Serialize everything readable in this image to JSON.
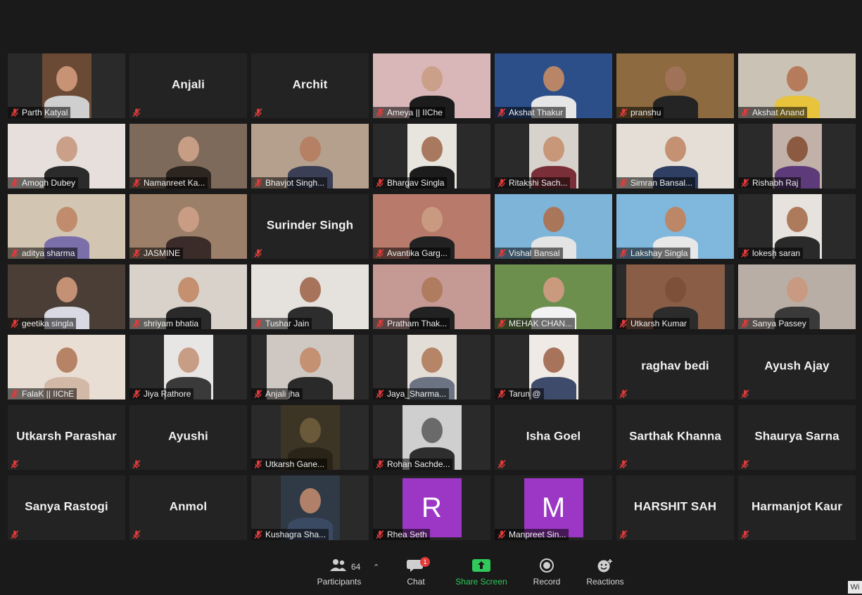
{
  "participants": [
    {
      "name": "Parth Katyal",
      "video": true,
      "bg": "#6b4a35",
      "skin": "#c89374",
      "shirt": "#cfcfcf",
      "frame": 70
    },
    {
      "name": "Anjali",
      "video": false
    },
    {
      "name": "Archit",
      "video": false
    },
    {
      "name": "Ameya || IIChe",
      "video": true,
      "bg": "#d9b7b9",
      "skin": "#caa08a",
      "shirt": "#1c1c1c",
      "frame": 0
    },
    {
      "name": "Akshat Thakur",
      "video": true,
      "bg": "#2c4f8a",
      "skin": "#b88667",
      "shirt": "#e6e6e6",
      "frame": 0
    },
    {
      "name": "pranshu",
      "video": true,
      "bg": "#8d6a3f",
      "skin": "#a07258",
      "shirt": "#242424",
      "frame": 0
    },
    {
      "name": "Akshat Anand",
      "video": true,
      "bg": "#c9c2b5",
      "skin": "#b57b5a",
      "shirt": "#e7c43c",
      "frame": 0
    },
    {
      "name": "Amogh Dubey",
      "video": true,
      "bg": "#e7dfdb",
      "skin": "#caa089",
      "shirt": "#2b2b2b",
      "frame": 0
    },
    {
      "name": "Namanreet Ka...",
      "video": true,
      "bg": "#7d6a5b",
      "skin": "#c79d84",
      "shirt": "#2d2520",
      "frame": 0
    },
    {
      "name": "Bhavjot Singh...",
      "video": true,
      "bg": "#b5a08d",
      "skin": "#b58064",
      "shirt": "#3a3f55",
      "frame": 0
    },
    {
      "name": "Bhargav Singla",
      "video": true,
      "bg": "#e8e4de",
      "skin": "#a8795e",
      "shirt": "#1c1c1c",
      "frame": 70
    },
    {
      "name": "Ritakshi Sach...",
      "video": true,
      "bg": "#d8d2cc",
      "skin": "#c89678",
      "shirt": "#7a2f38",
      "frame": 70
    },
    {
      "name": "Simran Bansal...",
      "video": true,
      "bg": "#e5ded6",
      "skin": "#c49273",
      "shirt": "#2f3f63",
      "frame": 0
    },
    {
      "name": "Rishabh Raj",
      "video": true,
      "bg": "#c2b1a8",
      "skin": "#8b5a40",
      "shirt": "#5d3b7a",
      "frame": 70
    },
    {
      "name": "aditya sharma",
      "video": true,
      "bg": "#d2c6b2",
      "skin": "#c08c6d",
      "shirt": "#7a6fa8",
      "frame": 0
    },
    {
      "name": "JASMINE",
      "video": true,
      "bg": "#9c7f68",
      "skin": "#c89d84",
      "shirt": "#3b2c2a",
      "frame": 0
    },
    {
      "name": "Surinder Singh",
      "video": false
    },
    {
      "name": "Avantika Garg...",
      "video": true,
      "bg": "#b87a6a",
      "skin": "#c99a80",
      "shirt": "#222222",
      "frame": 0
    },
    {
      "name": "Vishal Bansal",
      "video": true,
      "bg": "#7fb4d9",
      "skin": "#a97659",
      "shirt": "#e4e4e4",
      "frame": 0
    },
    {
      "name": "Lakshay Singla",
      "video": true,
      "bg": "#80b7dc",
      "skin": "#bb8766",
      "shirt": "#e8e8e8",
      "frame": 0
    },
    {
      "name": "lokesh saran",
      "video": true,
      "bg": "#e6e2dd",
      "skin": "#ae7a5c",
      "shirt": "#2a2a2a",
      "frame": 70
    },
    {
      "name": "geetika singla",
      "video": true,
      "bg": "#4a3e36",
      "skin": "#c49175",
      "shirt": "#d9d9e4",
      "frame": 0
    },
    {
      "name": "shriyam bhatia",
      "video": true,
      "bg": "#d8d2cb",
      "skin": "#c4906f",
      "shirt": "#2a2a2a",
      "frame": 0
    },
    {
      "name": "Tushar Jain",
      "video": true,
      "bg": "#e5e1dd",
      "skin": "#a7735a",
      "shirt": "#2d2d2d",
      "frame": 0
    },
    {
      "name": "Pratham Thak...",
      "video": true,
      "bg": "#c59a95",
      "skin": "#b07c60",
      "shirt": "#222222",
      "frame": 0
    },
    {
      "name": "MEHAK CHAN...",
      "video": true,
      "bg": "#6d8f4e",
      "skin": "#c99a7e",
      "shirt": "#f2f2f2",
      "frame": 0
    },
    {
      "name": "Utkarsh Kumar",
      "video": true,
      "bg": "#8a5d47",
      "skin": "#7d5039",
      "shirt": "#2c2c2c",
      "frame": 140
    },
    {
      "name": "Sanya Passey",
      "video": true,
      "bg": "#b9aea6",
      "skin": "#c89a82",
      "shirt": "#3a3a3a",
      "frame": 0
    },
    {
      "name": "FalaK || IIChE",
      "video": true,
      "bg": "#e9ded4",
      "skin": "#b78366",
      "shirt": "#d2b9a7",
      "frame": 0
    },
    {
      "name": "Jiya Rathore",
      "video": true,
      "bg": "#e8e6e4",
      "skin": "#c89d86",
      "shirt": "#3a3a3a",
      "frame": 70
    },
    {
      "name": "Anjali jha",
      "video": true,
      "bg": "#cfc8c2",
      "skin": "#c49173",
      "shirt": "#2a2a2a",
      "frame": 124
    },
    {
      "name": "Jaya_Sharma...",
      "video": true,
      "bg": "#e2ddd6",
      "skin": "#b68567",
      "shirt": "#6c7383",
      "frame": 70
    },
    {
      "name": "Tarun @",
      "video": true,
      "bg": "#efeae6",
      "skin": "#a7735a",
      "shirt": "#3e4b6b",
      "frame": 70
    },
    {
      "name": "raghav bedi",
      "video": false
    },
    {
      "name": "Ayush Ajay",
      "video": false
    },
    {
      "name": "Utkarsh Parashar",
      "video": false
    },
    {
      "name": "Ayushi",
      "video": false
    },
    {
      "name": "Utkarsh Gane...",
      "video": true,
      "bg": "#3c3526",
      "skin": "#6b5a3a",
      "shirt": "#2a2418",
      "frame": 84
    },
    {
      "name": "Rohan Sachde...",
      "video": true,
      "bg": "#cfcfcf",
      "skin": "#6a6a6a",
      "shirt": "#2e2e2e",
      "frame": 84
    },
    {
      "name": "Isha Goel",
      "video": false
    },
    {
      "name": "Sarthak Khanna",
      "video": false
    },
    {
      "name": "Shaurya Sarna",
      "video": false
    },
    {
      "name": "Sanya Rastogi",
      "video": false
    },
    {
      "name": "Anmol",
      "video": false
    },
    {
      "name": "Kushagra Sha...",
      "video": true,
      "bg": "#2f3a46",
      "skin": "#b08168",
      "shirt": "#3b4a63",
      "frame": 84
    },
    {
      "name": "Rhea Seth",
      "video": false,
      "avatar": "R"
    },
    {
      "name": "Manpreet Sin...",
      "video": false,
      "avatar": "M"
    },
    {
      "name": "HARSHIT SAH",
      "video": false
    },
    {
      "name": "Harmanjot Kaur",
      "video": false
    }
  ],
  "toolbar": {
    "participants_label": "Participants",
    "participants_count": "64",
    "chat_label": "Chat",
    "chat_badge": "1",
    "share_label": "Share Screen",
    "record_label": "Record",
    "reactions_label": "Reactions",
    "corner_text": "Wi"
  },
  "colors": {
    "avatar": "#9b37c4",
    "share": "#2fca5a",
    "mute": "#e23b3b",
    "badge": "#e23b3b"
  }
}
